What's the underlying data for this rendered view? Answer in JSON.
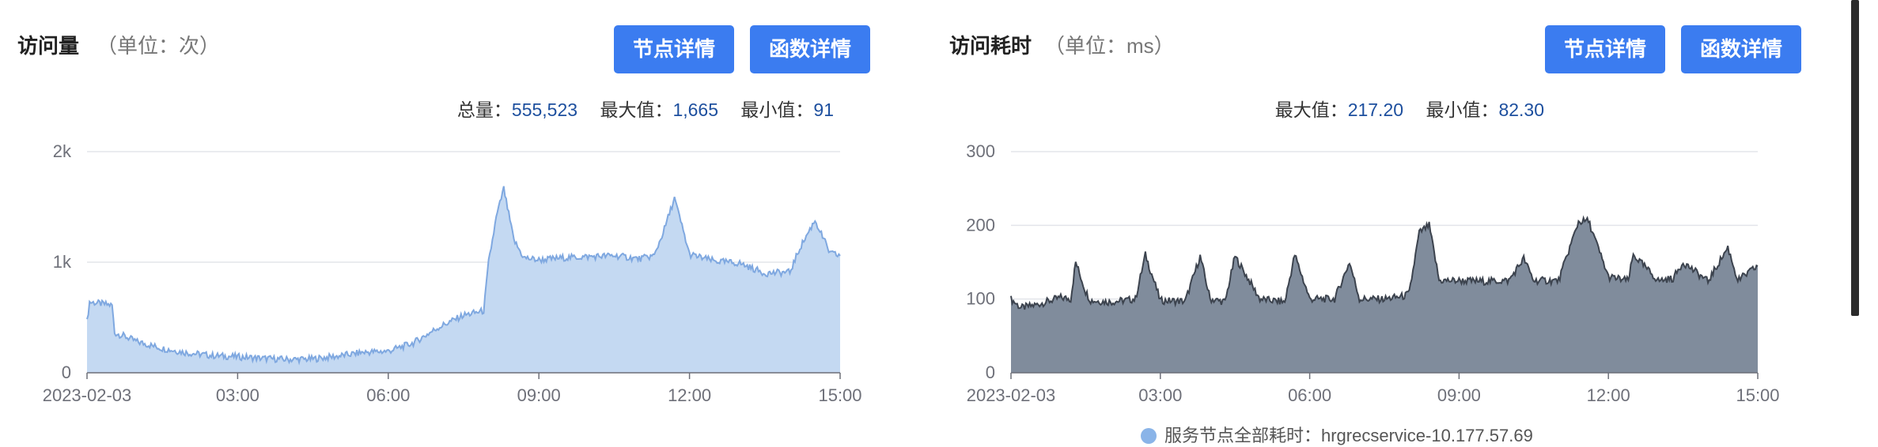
{
  "visits_panel": {
    "title": "访问量",
    "unit": "（单位：次）",
    "node_button": "节点详情",
    "func_button": "函数详情",
    "stats": [
      {
        "label": "总量：",
        "value": "555,523"
      },
      {
        "label": "最大值：",
        "value": "1,665"
      },
      {
        "label": "最小值：",
        "value": "91"
      }
    ]
  },
  "latency_panel": {
    "title": "访问耗时",
    "unit": "（单位：ms）",
    "node_button": "节点详情",
    "func_button": "函数详情",
    "stats": [
      {
        "label": "最大值：",
        "value": "217.20"
      },
      {
        "label": "最小值：",
        "value": "82.30"
      }
    ],
    "legend": "服务节点全部耗时：hrgrecservice-10.177.57.69"
  },
  "colors": {
    "visits_line": "#7fa8e0",
    "visits_fill": "#c4d9f2",
    "latency_line": "#3c434e",
    "latency_fill": "#808c9c",
    "button": "#3b7cf0",
    "stat_value": "#1d4f9e"
  },
  "chart_data": [
    {
      "type": "area",
      "xlabel": "",
      "ylabel": "",
      "x_ticks": [
        "2023-02-03",
        "03:00",
        "06:00",
        "09:00",
        "12:00",
        "15:00"
      ],
      "y_ticks": [
        "0",
        "1k",
        "2k"
      ],
      "ylim": [
        0,
        2000
      ],
      "x_range_hours": [
        0,
        15
      ],
      "grid": true,
      "series": [
        {
          "name": "",
          "x": [
            0.0,
            0.05,
            0.5,
            0.55,
            0.75,
            1.0,
            1.5,
            2.0,
            2.5,
            3.0,
            3.5,
            4.0,
            4.5,
            5.0,
            5.5,
            6.0,
            6.5,
            7.0,
            7.5,
            7.9,
            8.0,
            8.15,
            8.3,
            8.5,
            8.7,
            9.0,
            9.5,
            10.0,
            10.5,
            11.0,
            11.3,
            11.5,
            11.7,
            12.0,
            12.5,
            13.0,
            13.5,
            14.0,
            14.2,
            14.5,
            14.8,
            15.0
          ],
          "values": [
            460,
            640,
            610,
            360,
            330,
            280,
            220,
            180,
            155,
            145,
            130,
            120,
            125,
            150,
            185,
            195,
            270,
            410,
            520,
            560,
            1000,
            1400,
            1665,
            1200,
            1040,
            1020,
            1040,
            1050,
            1060,
            1030,
            1060,
            1300,
            1580,
            1070,
            1010,
            990,
            900,
            910,
            1130,
            1380,
            1080,
            1060
          ]
        }
      ]
    },
    {
      "type": "area",
      "xlabel": "",
      "ylabel": "",
      "x_ticks": [
        "2023-02-03",
        "03:00",
        "06:00",
        "09:00",
        "12:00",
        "15:00"
      ],
      "y_ticks": [
        "0",
        "100",
        "200",
        "300"
      ],
      "ylim": [
        0,
        300
      ],
      "x_range_hours": [
        0,
        15
      ],
      "grid": true,
      "series": [
        {
          "name": "服务节点全部耗时：hrgrecservice-10.177.57.69",
          "x": [
            0.0,
            0.2,
            0.5,
            1.0,
            1.2,
            1.3,
            1.5,
            1.6,
            2.0,
            2.5,
            2.7,
            3.0,
            3.5,
            3.8,
            4.0,
            4.3,
            4.5,
            5.0,
            5.5,
            5.7,
            6.0,
            6.5,
            6.8,
            7.0,
            7.5,
            7.9,
            8.0,
            8.2,
            8.4,
            8.6,
            9.0,
            9.5,
            10.0,
            10.3,
            10.5,
            11.0,
            11.4,
            11.6,
            12.0,
            12.4,
            12.5,
            13.0,
            13.3,
            13.5,
            14.0,
            14.4,
            14.6,
            15.0
          ],
          "values": [
            100,
            88,
            92,
            102,
            100,
            150,
            110,
            98,
            96,
            100,
            160,
            98,
            97,
            158,
            100,
            96,
            158,
            100,
            96,
            160,
            100,
            100,
            150,
            100,
            100,
            104,
            108,
            190,
            200,
            125,
            125,
            124,
            125,
            155,
            125,
            125,
            205,
            206,
            130,
            125,
            160,
            125,
            128,
            150,
            124,
            170,
            125,
            145
          ]
        }
      ]
    }
  ]
}
